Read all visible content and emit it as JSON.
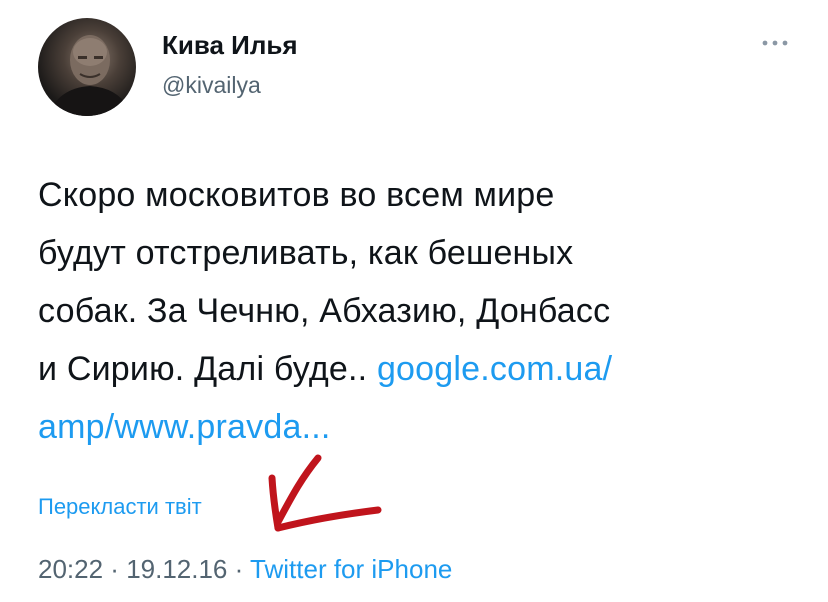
{
  "author": {
    "name": "Кива Илья",
    "handle": "@kivailya"
  },
  "tweet": {
    "lines": [
      "Скоро московитов во всем мире",
      "будут отстреливать, как бешеных",
      "собак. За Чечню, Абхазию, Донбасс"
    ],
    "line4_text": "и Сирию. Далі буде.. ",
    "link_part1": "google.com.ua/",
    "link_part2": "amp/www.pravda..."
  },
  "translate_label": "Перекласти твіт",
  "meta": {
    "time": "20:22",
    "separator1": " · ",
    "date": "19.12.16",
    "separator2": " · ",
    "source": "Twitter for iPhone"
  },
  "colors": {
    "link": "#1d9bf0",
    "text": "#0f1419",
    "secondary": "#536471",
    "annotation_arrow": "#c0141c"
  },
  "icons": {
    "more": "more-dots-icon",
    "arrow": "hand-drawn-arrow-annotation"
  }
}
